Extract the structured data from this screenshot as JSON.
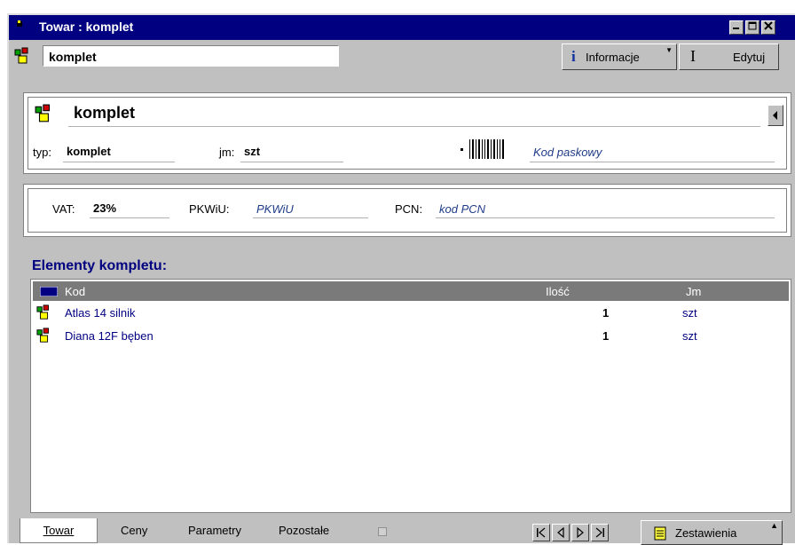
{
  "window": {
    "title": "Towar : komplet"
  },
  "toolbar": {
    "name_value": "komplet",
    "info_label": "Informacje",
    "edit_label": "Edytuj"
  },
  "product": {
    "name": "komplet",
    "typ_label": "typ:",
    "typ_value": "komplet",
    "jm_label": "jm:",
    "jm_value": "szt",
    "barcode": "Kod paskowy"
  },
  "tax": {
    "vat_label": "VAT:",
    "vat_value": "23%",
    "pkwiu_label": "PKWiU:",
    "pkwiu_value": "PKWiU",
    "pcn_label": "PCN:",
    "pcn_value": "kod PCN"
  },
  "elements": {
    "title": "Elementy kompletu:",
    "columns": {
      "kod": "Kod",
      "ilosc": "Ilość",
      "jm": "Jm"
    },
    "rows": [
      {
        "kod": "Atlas 14 silnik",
        "ilosc": "1",
        "jm": "szt"
      },
      {
        "kod": "Diana 12F bęben",
        "ilosc": "1",
        "jm": "szt"
      }
    ]
  },
  "tabs": {
    "towar": "Towar",
    "ceny": "Ceny",
    "parametry": "Parametry",
    "pozostale": "Pozostałe"
  },
  "bottom": {
    "summary_label": "Zestawienia"
  }
}
